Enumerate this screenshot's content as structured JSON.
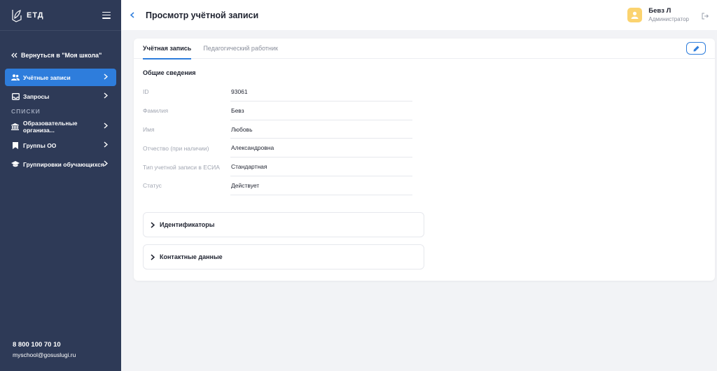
{
  "sidebar": {
    "logo_text": "ЕТД",
    "back_label": "Вернуться в \"Моя школа\"",
    "items": [
      {
        "label": "Учётные записи",
        "icon": "users-icon",
        "active": true
      },
      {
        "label": "Запросы",
        "icon": "inbox-icon",
        "active": false
      }
    ],
    "section_title": "СПИСКИ",
    "list_items": [
      {
        "label": "Образовательные организа...",
        "icon": "institution-icon"
      },
      {
        "label": "Группы ОО",
        "icon": "bookmark-icon"
      },
      {
        "label": "Группировки обучающихся",
        "icon": "graduation-cap-icon"
      }
    ],
    "phone": "8 800 100 70 10",
    "email": "myschool@gosuslugi.ru"
  },
  "header": {
    "title": "Просмотр учётной записи",
    "user_name": "Бевз Л",
    "user_role": "Администратор"
  },
  "tabs": [
    {
      "label": "Учётная запись",
      "active": true
    },
    {
      "label": "Педагогический работник",
      "active": false
    }
  ],
  "section": {
    "title": "Общие сведения",
    "fields": [
      {
        "label": "ID",
        "value": "93061"
      },
      {
        "label": "Фамилия",
        "value": "Бевз"
      },
      {
        "label": "Имя",
        "value": "Любовь"
      },
      {
        "label": "Отчество (при наличии)",
        "value": "Александровна"
      },
      {
        "label": "Тип учетной записи в ЕСИА",
        "value": "Стандартная"
      },
      {
        "label": "Статус",
        "value": "Действует"
      }
    ]
  },
  "accordions": [
    {
      "label": "Идентификаторы"
    },
    {
      "label": "Контактные данные"
    }
  ],
  "colors": {
    "sidebar_bg": "#2e3a57",
    "accent": "#2e7ddc",
    "avatar": "#fbd36f"
  }
}
